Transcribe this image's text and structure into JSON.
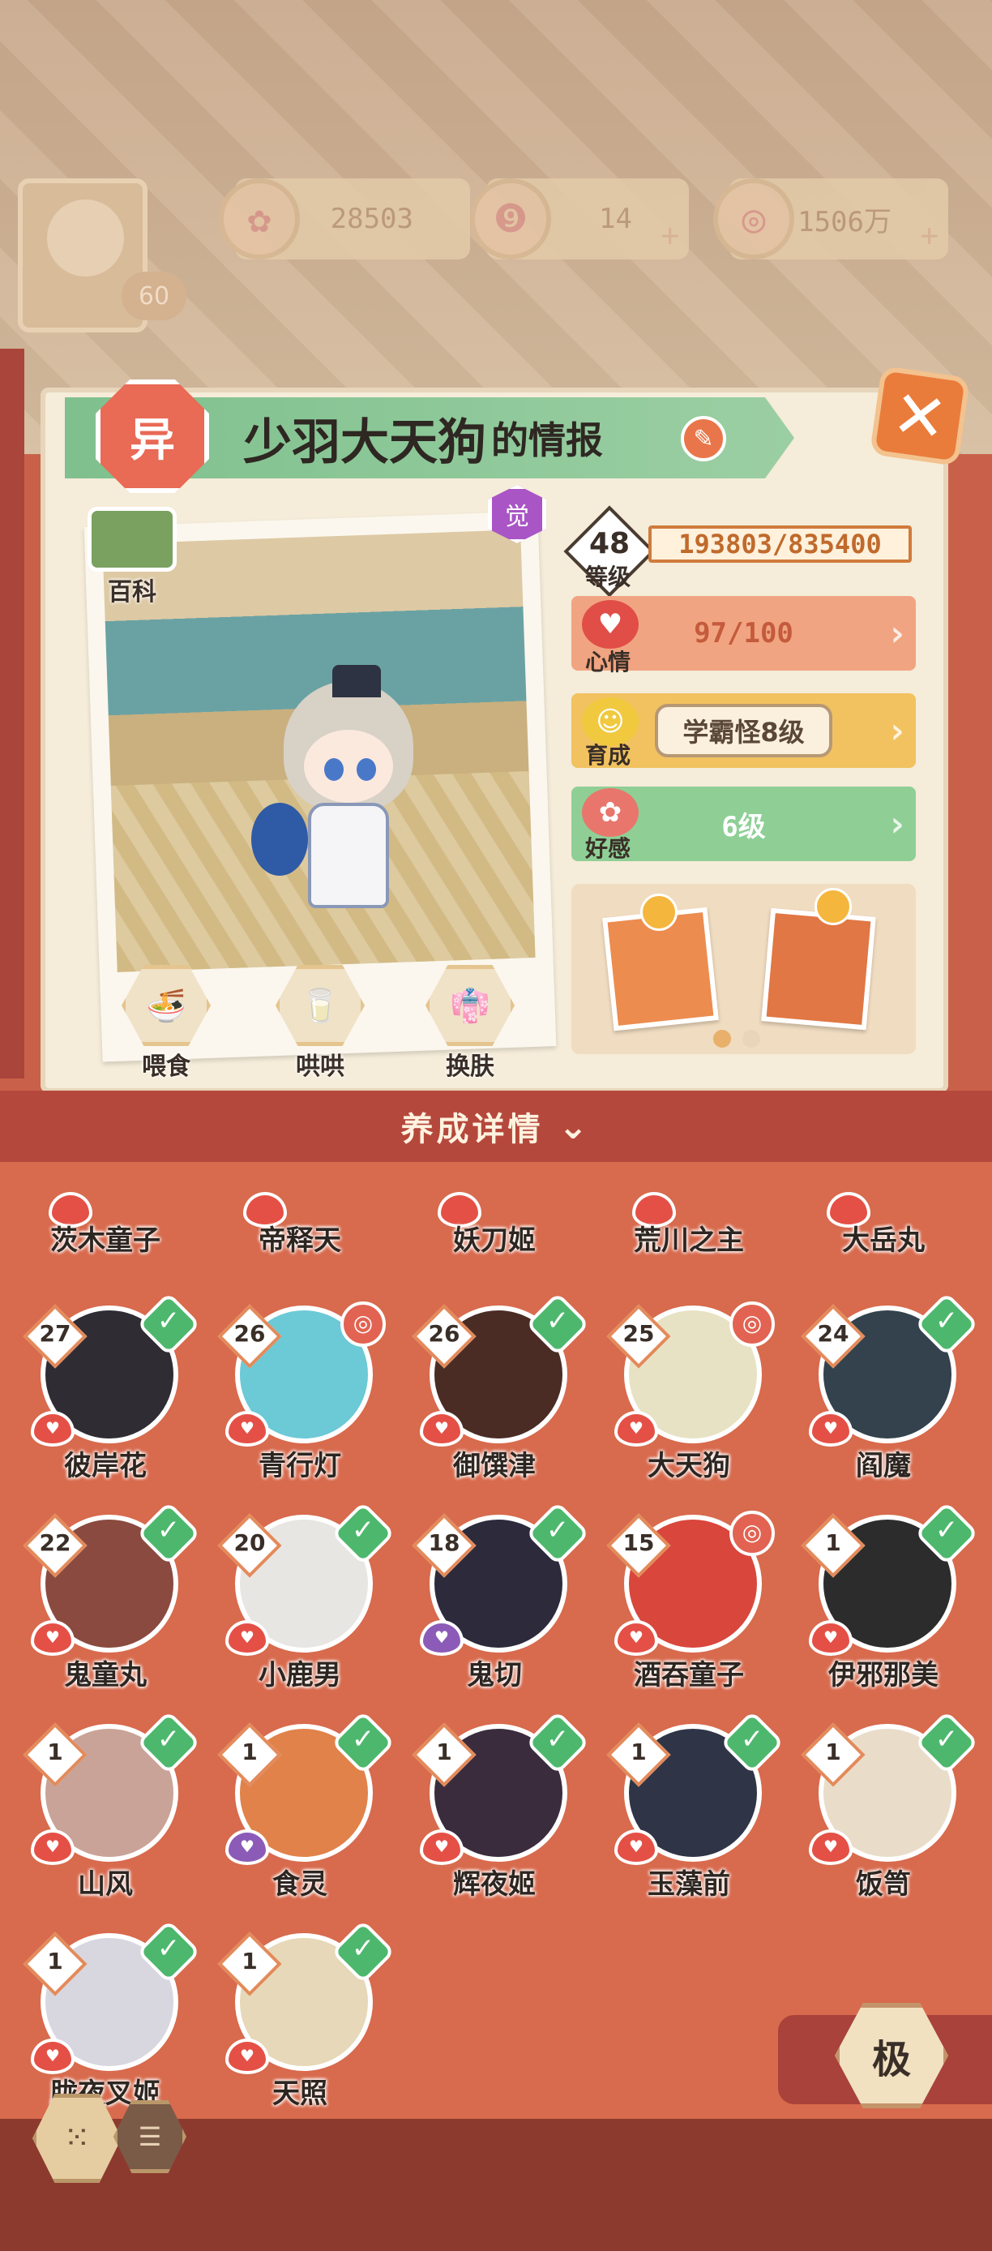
{
  "currency": {
    "player_level": "60",
    "sakura": "28503",
    "magatama": "14",
    "coins": "1506万"
  },
  "header": {
    "badge": "异",
    "name": "少羽大天狗",
    "suffix": "的情报",
    "close_label": "✕"
  },
  "portrait": {
    "awaken_badge": "觉",
    "encyclopedia": "百科",
    "actions": [
      {
        "label": "喂食",
        "icon": "bowl-icon"
      },
      {
        "label": "哄哄",
        "icon": "milk-icon"
      },
      {
        "label": "换肤",
        "icon": "kimono-icon"
      }
    ]
  },
  "stats": {
    "level": "48",
    "level_label": "等级",
    "exp": "193803/835400",
    "mood_label": "心情",
    "mood_value": "97/100",
    "growth_label": "育成",
    "growth_value": "学霸怪8级",
    "favor_label": "好感",
    "favor_value": "6级"
  },
  "detail_bar": "养成详情",
  "partial_row": [
    "茨木童子",
    "帝释天",
    "妖刀姬",
    "荒川之主",
    "大岳丸"
  ],
  "shikigami": [
    {
      "level": "27",
      "name": "彼岸花",
      "mark": "check",
      "color": "#2f2c33"
    },
    {
      "level": "26",
      "name": "青行灯",
      "mark": "status",
      "color": "#6cc9d6"
    },
    {
      "level": "26",
      "name": "御馔津",
      "mark": "check",
      "color": "#4a2c25"
    },
    {
      "level": "25",
      "name": "大天狗",
      "mark": "status",
      "color": "#e8e2c4"
    },
    {
      "level": "24",
      "name": "阎魔",
      "mark": "check",
      "color": "#33424c"
    },
    {
      "level": "22",
      "name": "鬼童丸",
      "mark": "check",
      "color": "#8a4a3f"
    },
    {
      "level": "20",
      "name": "小鹿男",
      "mark": "check",
      "color": "#e8e6e2"
    },
    {
      "level": "18",
      "name": "鬼切",
      "mark": "check",
      "color": "#2d2a3c"
    },
    {
      "level": "15",
      "name": "酒吞童子",
      "mark": "status",
      "color": "#d9463c"
    },
    {
      "level": "1",
      "name": "伊邪那美",
      "mark": "check",
      "color": "#2c2c2c"
    },
    {
      "level": "1",
      "name": "山风",
      "mark": "check",
      "color": "#c9a397"
    },
    {
      "level": "1",
      "name": "食灵",
      "mark": "check",
      "color": "#e0824a"
    },
    {
      "level": "1",
      "name": "辉夜姬",
      "mark": "check",
      "color": "#3b2c3d"
    },
    {
      "level": "1",
      "name": "玉藻前",
      "mark": "check",
      "color": "#2f3447"
    },
    {
      "level": "1",
      "name": "饭笥",
      "mark": "check",
      "color": "#e9ddca"
    },
    {
      "level": "1",
      "name": "胧夜叉姬",
      "mark": "check",
      "color": "#d8d6df"
    },
    {
      "level": "1",
      "name": "天照",
      "mark": "check",
      "color": "#e6d8b8"
    }
  ],
  "bottom": {
    "ji_label": "极"
  }
}
